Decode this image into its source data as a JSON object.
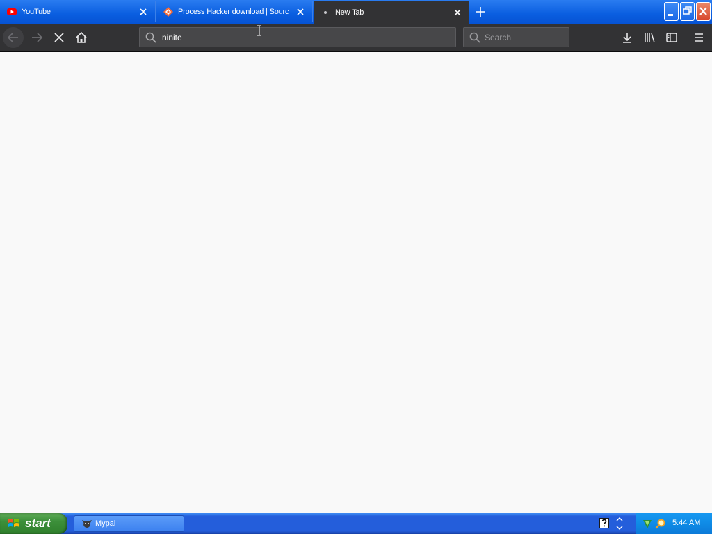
{
  "tabs": [
    {
      "label": "YouTube",
      "favicon": "youtube-icon"
    },
    {
      "label": "Process Hacker download | Sourc",
      "favicon": "sourceforge-icon"
    },
    {
      "label": "New Tab",
      "favicon": "loading-dot-icon",
      "active": true
    }
  ],
  "toolbar": {
    "url_value": "ninite",
    "search_placeholder": "Search"
  },
  "taskbar": {
    "start_label": "start",
    "task_label": "Mypal",
    "clock": "5:44 AM"
  },
  "colors": {
    "titlebar_blue": "#0a5ee0",
    "toolbar_dark": "#323234",
    "taskbar_blue": "#245edb",
    "start_green": "#3c8f3a",
    "close_red": "#d9482c",
    "youtube_red": "#ff0000"
  }
}
